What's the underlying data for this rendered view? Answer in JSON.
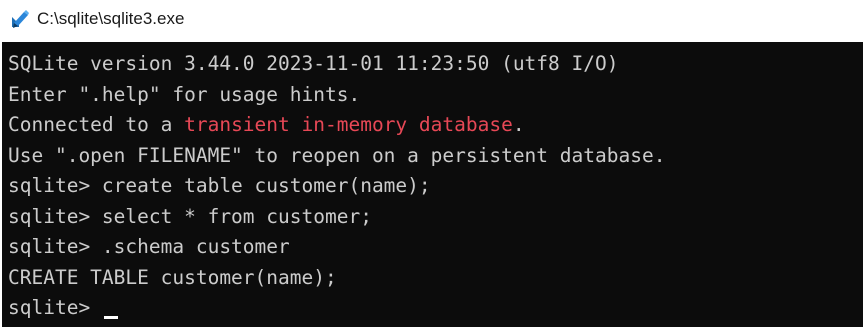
{
  "window": {
    "title": "C:\\sqlite\\sqlite3.exe",
    "icon": "pen-brush-icon"
  },
  "console": {
    "lines": [
      {
        "text": "SQLite version 3.44.0 2023-11-01 11:23:50 (utf8 I/O)"
      },
      {
        "text": "Enter \".help\" for usage hints."
      },
      {
        "prefix": "Connected to a ",
        "highlight": "transient in-memory database",
        "suffix": "."
      },
      {
        "text": "Use \".open FILENAME\" to reopen on a persistent database."
      },
      {
        "prompt": "sqlite> ",
        "command": "create table customer(name);"
      },
      {
        "prompt": "sqlite> ",
        "command": "select * from customer;"
      },
      {
        "prompt": "sqlite> ",
        "command": ".schema customer"
      },
      {
        "text": "CREATE TABLE customer(name);"
      },
      {
        "prompt": "sqlite> ",
        "command": ""
      }
    ],
    "colors": {
      "background": "#0c0c0c",
      "foreground": "#cccccc",
      "highlight": "#e74856"
    }
  }
}
